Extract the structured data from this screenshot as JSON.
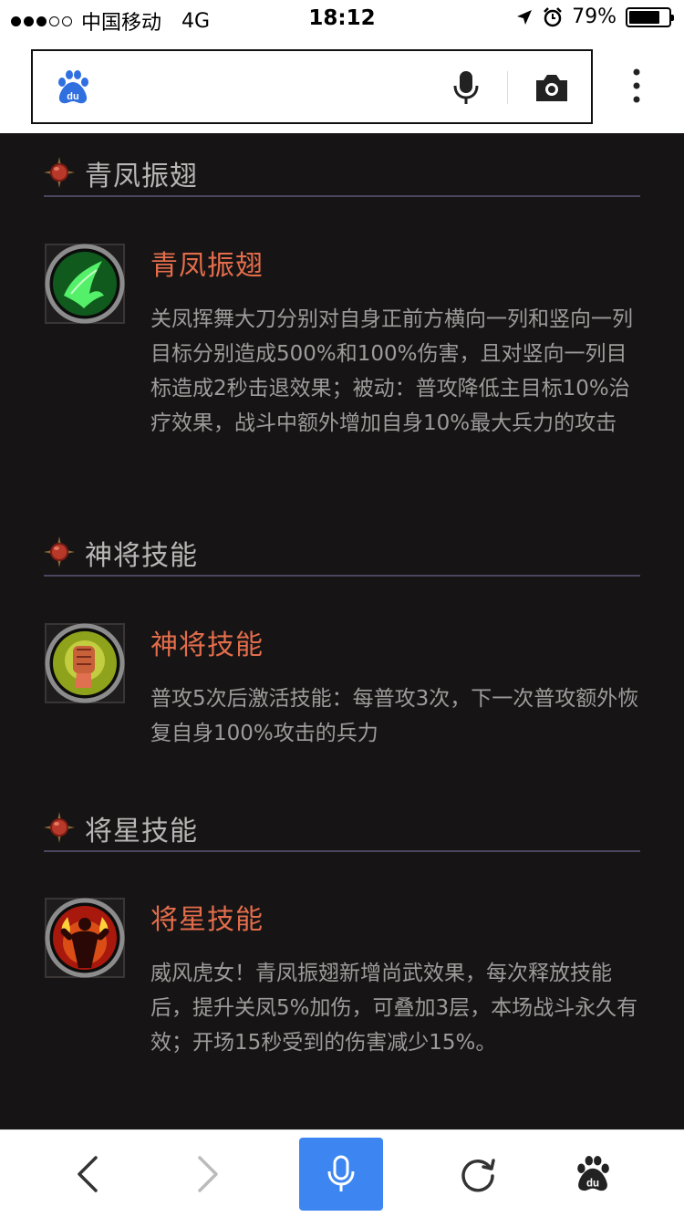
{
  "status_bar": {
    "carrier": "中国移动",
    "network": "4G",
    "time": "18:12",
    "battery": "79%",
    "battery_level": 0.79
  },
  "search": {
    "logo": "baidu-logo",
    "icons": [
      "microphone-icon",
      "camera-icon",
      "more-vertical-icon"
    ]
  },
  "sections": [
    {
      "header": "青凤振翅",
      "skill_name": "青凤振翅",
      "description": "关凤挥舞大刀分别对自身正前方横向一列和竖向一列目标分别造成500%和100%伤害，且对竖向一列目标造成2秒击退效果；被动：普攻降低主目标10%治疗效果，战斗中额外增加自身10%最大兵力的攻击",
      "icon": "wing-slash-icon"
    },
    {
      "header": "神将技能",
      "skill_name": "神将技能",
      "description": "普攻5次后激活技能：每普攻3次，下一次普攻额外恢复自身100%攻击的兵力",
      "icon": "fist-icon"
    },
    {
      "header": "将星技能",
      "skill_name": "将星技能",
      "description": "威风虎女！青凤振翅新增尚武效果，每次释放技能后，提升关凤5%加伤，可叠加3层，本场战斗永久有效；开场15秒受到的伤害减少15%。",
      "icon": "flame-warrior-icon"
    }
  ],
  "toolbar": {
    "items": [
      "back-icon",
      "forward-icon",
      "voice-icon",
      "refresh-icon",
      "baidu-home-icon"
    ]
  },
  "colors": {
    "background": "#161415",
    "skill_name": "#e36d4b",
    "section_title": "#b8b7b5",
    "description": "#9d9c9a",
    "divider": "#4b4560",
    "voice_button": "#3d86f2"
  }
}
